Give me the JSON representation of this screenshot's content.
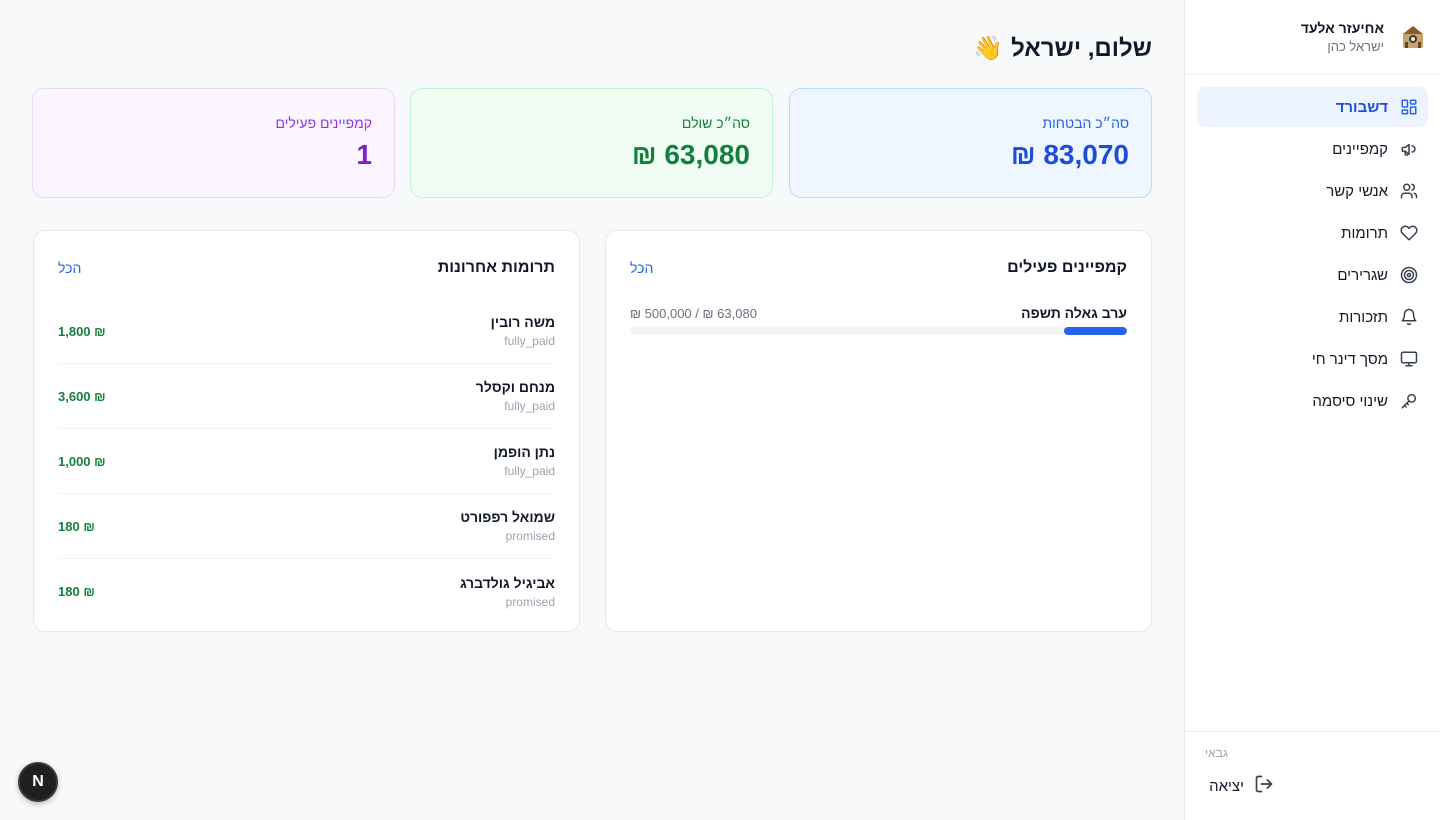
{
  "sidebar": {
    "user_name": "אחיעזר אלעד",
    "user_sub": "ישראל כהן",
    "items": [
      {
        "label": "דשבורד",
        "icon": "dashboard-icon"
      },
      {
        "label": "קמפיינים",
        "icon": "megaphone-icon"
      },
      {
        "label": "אנשי קשר",
        "icon": "users-icon"
      },
      {
        "label": "תרומות",
        "icon": "heart-icon"
      },
      {
        "label": "שגרירים",
        "icon": "target-icon"
      },
      {
        "label": "תזכורות",
        "icon": "bell-icon"
      },
      {
        "label": "מסך דינר חי",
        "icon": "monitor-icon"
      },
      {
        "label": "שינוי סיסמה",
        "icon": "key-icon"
      }
    ],
    "role": "גבאי",
    "logout_label": "יציאה"
  },
  "header": {
    "greeting": "שלום, ישראל",
    "emoji": "👋"
  },
  "stats": {
    "pledges": {
      "label": "סה״כ הבטחות",
      "value": "83,070 ₪"
    },
    "paid": {
      "label": "סה״כ שולם",
      "value": "63,080 ₪"
    },
    "active_campaigns": {
      "label": "קמפיינים פעילים",
      "value": "1"
    }
  },
  "campaigns_card": {
    "title": "קמפיינים פעילים",
    "link": "הכל",
    "items": [
      {
        "name": "ערב גאלה תשפה",
        "amount": "63,080 ₪ / 500,000 ₪",
        "progress": 0.126
      }
    ]
  },
  "donations_card": {
    "title": "תרומות אחרונות",
    "link": "הכל",
    "items": [
      {
        "name": "משה רובין",
        "status": "fully_paid",
        "amount": "₪ 1,800"
      },
      {
        "name": "מנחם וקסלר",
        "status": "fully_paid",
        "amount": "₪ 3,600"
      },
      {
        "name": "נתן הופמן",
        "status": "fully_paid",
        "amount": "₪ 1,000"
      },
      {
        "name": "שמואל רפפורט",
        "status": "promised",
        "amount": "₪ 180"
      },
      {
        "name": "אביגיל גולדברג",
        "status": "promised",
        "amount": "₪ 180"
      }
    ]
  },
  "badge": {
    "letter": "N"
  },
  "colors": {
    "accent": "#2563eb",
    "paid": "#15803d",
    "campaigns": "#7e22ce"
  }
}
